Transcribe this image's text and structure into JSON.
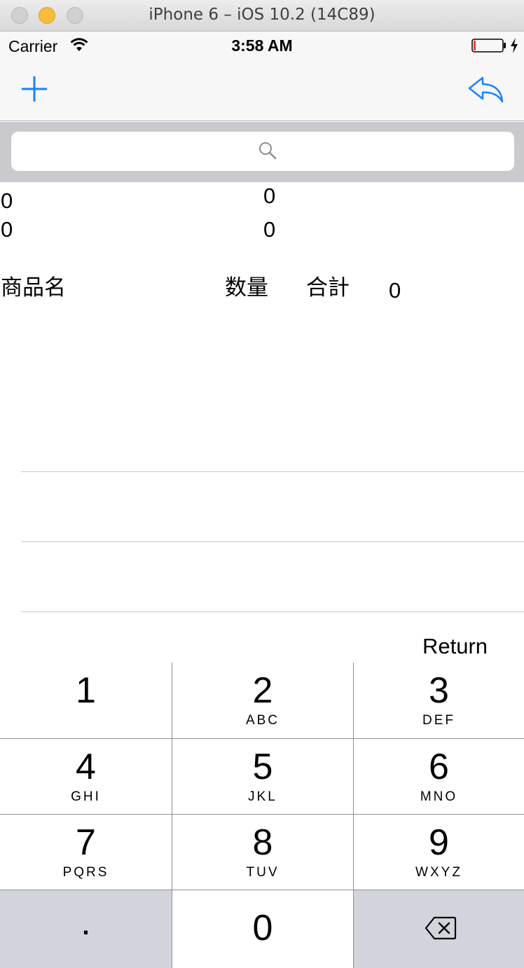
{
  "window": {
    "title": "iPhone 6 – iOS 10.2 (14C89)"
  },
  "status_bar": {
    "carrier": "Carrier",
    "time": "3:58 AM"
  },
  "nav_bar": {
    "left_icon": "plus-icon",
    "right_icon": "reply-arrow-icon",
    "accent_color": "#1a82fb"
  },
  "search": {
    "placeholder": ""
  },
  "summary": {
    "row1_left": "0",
    "row1_right": "0",
    "row2_left": "0",
    "row2_right": "0"
  },
  "table_header": {
    "product_name": "商品名",
    "quantity": "数量",
    "total_label": "合計",
    "total_value": "0"
  },
  "keyboard": {
    "return_label": "Return",
    "keys": [
      {
        "num": "1",
        "letters": ""
      },
      {
        "num": "2",
        "letters": "ABC"
      },
      {
        "num": "3",
        "letters": "DEF"
      },
      {
        "num": "4",
        "letters": "GHI"
      },
      {
        "num": "5",
        "letters": "JKL"
      },
      {
        "num": "6",
        "letters": "MNO"
      },
      {
        "num": "7",
        "letters": "PQRS"
      },
      {
        "num": "8",
        "letters": "TUV"
      },
      {
        "num": "9",
        "letters": "WXYZ"
      },
      {
        "num": ".",
        "letters": ""
      },
      {
        "num": "0",
        "letters": ""
      },
      {
        "num": "",
        "letters": "",
        "icon": "delete-backspace-icon"
      }
    ]
  }
}
